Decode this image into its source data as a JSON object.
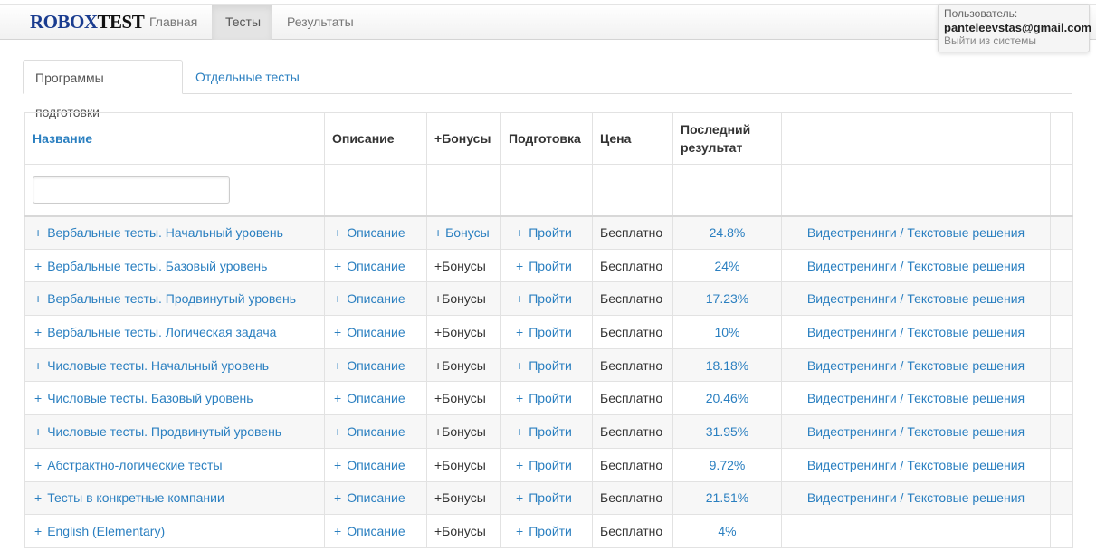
{
  "navbar": {
    "brand_part1": "ROBOX",
    "brand_part2": "TEST",
    "items": [
      {
        "label": "Главная",
        "active": false
      },
      {
        "label": "Тесты",
        "active": true
      },
      {
        "label": "Результаты",
        "active": false
      }
    ]
  },
  "user": {
    "label": "Пользователь:",
    "email": "panteleevstas@gmail.com",
    "logout": "Выйти из системы"
  },
  "tabs": [
    {
      "label": "Программы подготовки",
      "active": true
    },
    {
      "label": "Отдельные тесты",
      "active": false
    }
  ],
  "table": {
    "headers": {
      "name": "Название",
      "description": "Описание",
      "bonus": "+Бонусы",
      "prep": "Подготовка",
      "price": "Цена",
      "last_result": "Последний результат"
    },
    "filter_placeholder": "",
    "plus": "+",
    "rows": [
      {
        "name": "Вербальные тесты. Начальный уровень",
        "description": "Описание",
        "bonus": "+ Бонусы",
        "bonus_link": true,
        "prep": "Пройти",
        "price": "Бесплатно",
        "result": "24.8%",
        "extra": "Видеотренинги / Текстовые решения"
      },
      {
        "name": "Вербальные тесты. Базовый уровень",
        "description": "Описание",
        "bonus": "+Бонусы",
        "bonus_link": false,
        "prep": "Пройти",
        "price": "Бесплатно",
        "result": "24%",
        "extra": "Видеотренинги / Текстовые решения"
      },
      {
        "name": "Вербальные тесты. Продвинутый уровень",
        "description": "Описание",
        "bonus": "+Бонусы",
        "bonus_link": false,
        "prep": "Пройти",
        "price": "Бесплатно",
        "result": "17.23%",
        "extra": "Видеотренинги / Текстовые решения"
      },
      {
        "name": "Вербальные тесты. Логическая задача",
        "description": "Описание",
        "bonus": "+Бонусы",
        "bonus_link": false,
        "prep": "Пройти",
        "price": "Бесплатно",
        "result": "10%",
        "extra": "Видеотренинги / Текстовые решения"
      },
      {
        "name": "Числовые тесты. Начальный уровень",
        "description": "Описание",
        "bonus": "+Бонусы",
        "bonus_link": false,
        "prep": "Пройти",
        "price": "Бесплатно",
        "result": "18.18%",
        "extra": "Видеотренинги / Текстовые решения"
      },
      {
        "name": "Числовые тесты. Базовый уровень",
        "description": "Описание",
        "bonus": "+Бонусы",
        "bonus_link": false,
        "prep": "Пройти",
        "price": "Бесплатно",
        "result": "20.46%",
        "extra": "Видеотренинги / Текстовые решения"
      },
      {
        "name": "Числовые тесты. Продвинутый уровень",
        "description": "Описание",
        "bonus": "+Бонусы",
        "bonus_link": false,
        "prep": "Пройти",
        "price": "Бесплатно",
        "result": "31.95%",
        "extra": "Видеотренинги / Текстовые решения"
      },
      {
        "name": "Абстрактно-логические тесты",
        "description": "Описание",
        "bonus": "+Бонусы",
        "bonus_link": false,
        "prep": "Пройти",
        "price": "Бесплатно",
        "result": "9.72%",
        "extra": "Видеотренинги / Текстовые решения"
      },
      {
        "name": "Тесты в конкретные компании",
        "description": "Описание",
        "bonus": "+Бонусы",
        "bonus_link": false,
        "prep": "Пройти",
        "price": "Бесплатно",
        "result": "21.51%",
        "extra": "Видеотренинги / Текстовые решения"
      },
      {
        "name": "English (Elementary)",
        "description": "Описание",
        "bonus": "+Бонусы",
        "bonus_link": false,
        "prep": "Пройти",
        "price": "Бесплатно",
        "result": "4%",
        "extra": ""
      }
    ]
  },
  "colors": {
    "brand_blue": "#1a3c8f",
    "link": "#2a7fc0"
  }
}
